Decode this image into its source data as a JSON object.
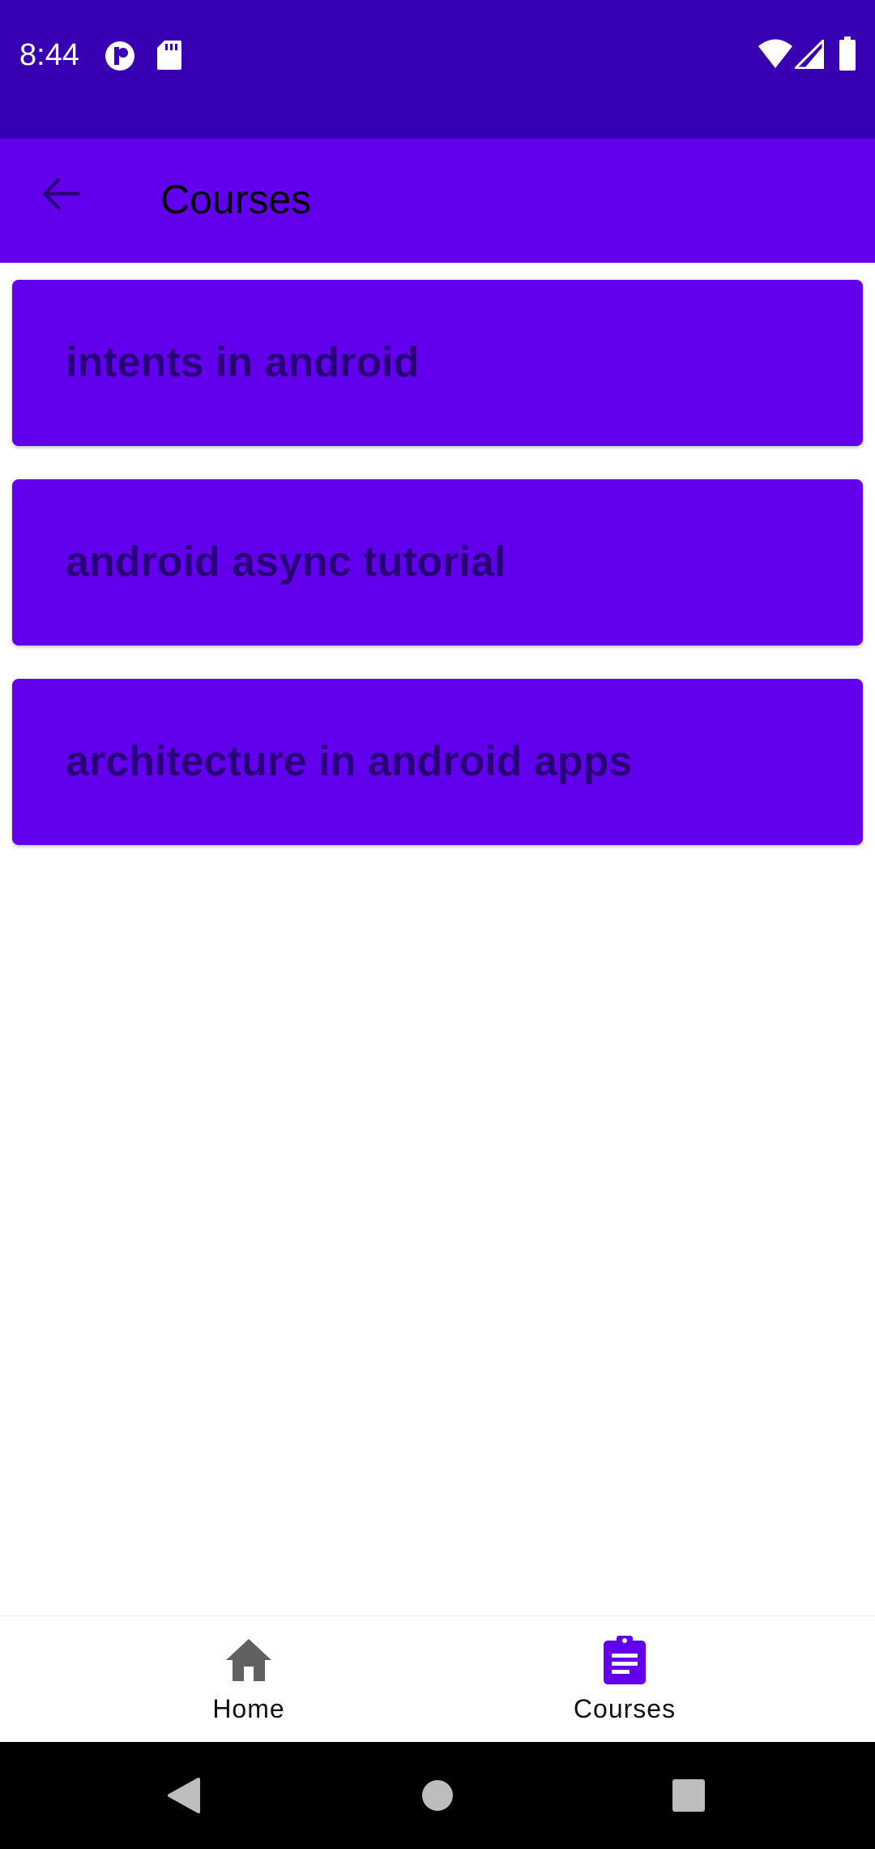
{
  "status_bar": {
    "time": "8:44",
    "background_color": "#3700B3",
    "icons": [
      "data-saver-icon",
      "sd-card-icon",
      "wifi-icon",
      "signal-icon",
      "battery-icon"
    ]
  },
  "app_bar": {
    "title": "Courses",
    "back_icon": "arrow-back-icon",
    "background_color": "#6200EE"
  },
  "courses": [
    {
      "title": "intents in android"
    },
    {
      "title": "android async tutorial"
    },
    {
      "title": "architecture in android apps"
    }
  ],
  "bottom_nav": {
    "items": [
      {
        "label": "Home",
        "icon": "home-icon",
        "selected": false
      },
      {
        "label": "Courses",
        "icon": "assignment-icon",
        "selected": true
      }
    ],
    "selected_color": "#6200EE",
    "unselected_color": "#616161"
  },
  "system_nav": {
    "buttons": [
      "back-triangle-icon",
      "home-circle-icon",
      "recents-square-icon"
    ]
  }
}
